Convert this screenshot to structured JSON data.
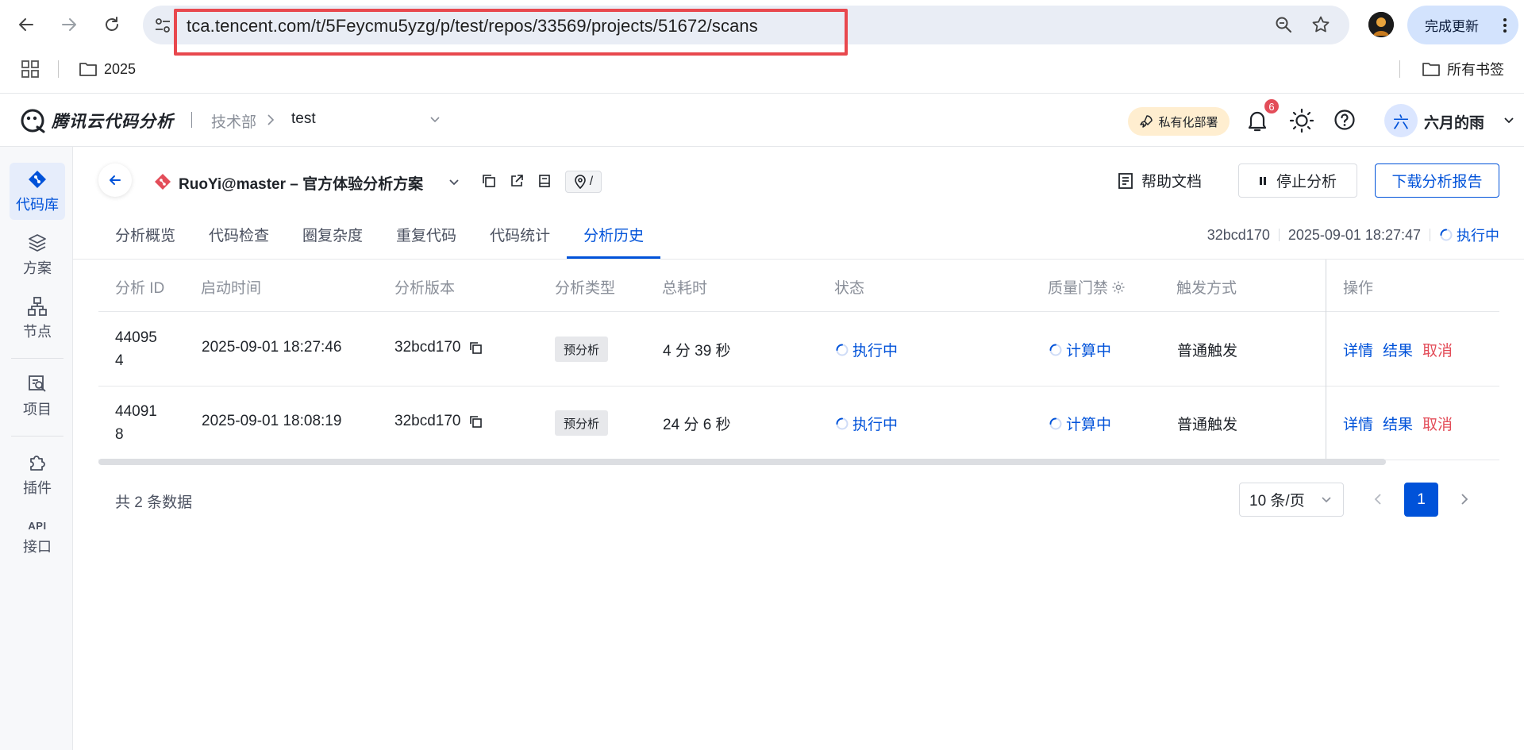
{
  "browser": {
    "url": "tca.tencent.com/t/5Feycmu5yzg/p/test/repos/33569/projects/51672/scans",
    "update_label": "完成更新",
    "bookmarks": [
      {
        "label": "2025"
      },
      {
        "label": "所有书签"
      }
    ]
  },
  "header": {
    "app_name": "腾讯云代码分析",
    "org": "技术部",
    "team": "test",
    "deploy_label": "私有化部署",
    "notification_count": "6",
    "avatar_char": "六",
    "user_name": "六月的雨"
  },
  "sidebar": {
    "items": [
      {
        "label": "代码库",
        "icon": "code-repo-icon",
        "active": true
      },
      {
        "label": "方案",
        "icon": "layers-icon"
      },
      {
        "label": "节点",
        "icon": "nodes-icon"
      },
      {
        "label": "项目",
        "icon": "project-icon"
      },
      {
        "label": "插件",
        "icon": "puzzle-icon"
      },
      {
        "label": "接口",
        "icon": "api-icon",
        "tag": "API"
      }
    ]
  },
  "project": {
    "title": "RuoYi@master – 官方体验分析方案",
    "path": "/",
    "help_doc_label": "帮助文档",
    "stop_label": "停止分析",
    "download_label": "下载分析报告"
  },
  "tabs": [
    {
      "label": "分析概览"
    },
    {
      "label": "代码检查"
    },
    {
      "label": "圈复杂度"
    },
    {
      "label": "重复代码"
    },
    {
      "label": "代码统计"
    },
    {
      "label": "分析历史",
      "active": true
    }
  ],
  "scan_meta": {
    "version": "32bcd170",
    "time": "2025-09-01 18:27:47",
    "status": "执行中"
  },
  "table": {
    "columns": [
      "分析 ID",
      "启动时间",
      "分析版本",
      "分析类型",
      "总耗时",
      "状态",
      "质量门禁",
      "触发方式",
      "操作"
    ],
    "rows": [
      {
        "id": "440954",
        "start": "2025-09-01 18:27:46",
        "version": "32bcd170",
        "type": "预分析",
        "duration": "4 分 39 秒",
        "status": "执行中",
        "gate": "计算中",
        "trigger": "普通触发",
        "ops": [
          "详情",
          "结果",
          "取消"
        ]
      },
      {
        "id": "440918",
        "start": "2025-09-01 18:08:19",
        "version": "32bcd170",
        "type": "预分析",
        "duration": "24 分 6 秒",
        "status": "执行中",
        "gate": "计算中",
        "trigger": "普通触发",
        "ops": [
          "详情",
          "结果",
          "取消"
        ]
      }
    ]
  },
  "pagination": {
    "total_text": "共 2 条数据",
    "page_size": "10 条/页",
    "current_page": "1"
  },
  "colors": {
    "primary": "#0052d9",
    "danger": "#e34d59",
    "highlight_box": "#e8484e"
  }
}
